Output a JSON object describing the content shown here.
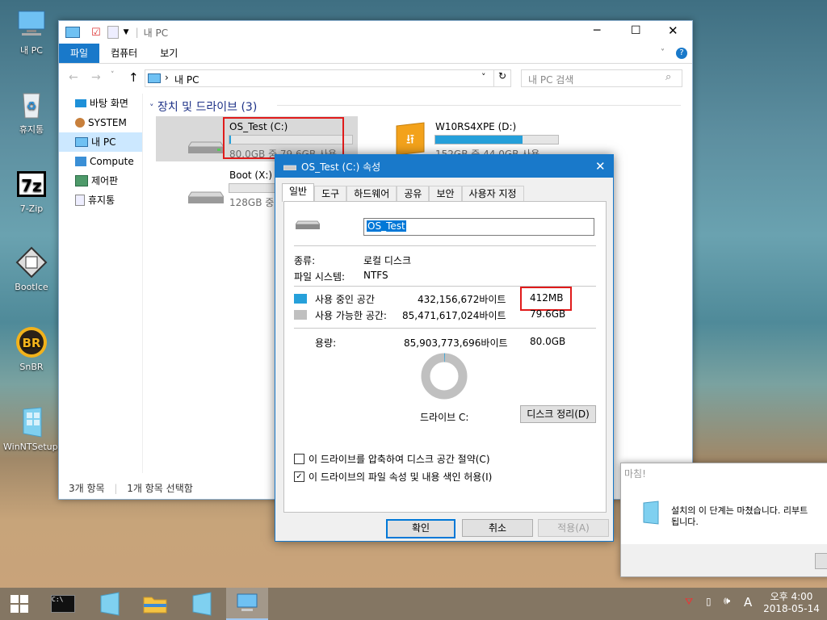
{
  "desktop_icons": [
    {
      "label": "내 PC",
      "icon": "this-pc-icon"
    },
    {
      "label": "휴지통",
      "icon": "recycle-bin-icon"
    },
    {
      "label": "7-Zip",
      "icon": "7zip-icon"
    },
    {
      "label": "BootIce",
      "icon": "bootice-icon"
    },
    {
      "label": "SnBR",
      "icon": "snbr-icon"
    },
    {
      "label": "WinNTSetup:",
      "icon": "winntsetup-icon"
    }
  ],
  "explorer": {
    "title": "내 PC",
    "ribbon_tabs": [
      "파일",
      "컴퓨터",
      "보기"
    ],
    "address_path": "내 PC",
    "search_placeholder": "내 PC 검색",
    "section_header": "장치 및 드라이브 (3)",
    "nav_items": [
      "바탕 화면",
      "SYSTEM",
      "내 PC",
      "Compute",
      "제어판",
      "휴지통"
    ],
    "drives": [
      {
        "name": "OS_Test (C:)",
        "info": "80.0GB 중 79.6GB 사용",
        "fill": 0.01
      },
      {
        "name": "W10RS4XPE (D:)",
        "info": "152GB 중 44.0GB 사용",
        "fill": 0.71
      },
      {
        "name": "Boot (X:)",
        "info": "128GB 중",
        "fill": 0.0
      }
    ],
    "status_items": "3개 항목",
    "status_selected": "1개 항목 선택함"
  },
  "properties": {
    "title": "OS_Test (C:) 속성",
    "tabs": [
      "일반",
      "도구",
      "하드웨어",
      "공유",
      "보안",
      "사용자 지정"
    ],
    "name_value": "OS_Test",
    "type_label": "종류:",
    "type_value": "로컬 디스크",
    "fs_label": "파일 시스템:",
    "fs_value": "NTFS",
    "used_label": "사용 중인 공간",
    "used_bytes": "432,156,672바이트",
    "used_size": "412MB",
    "free_label": "사용 가능한 공간:",
    "free_bytes": "85,471,617,024바이트",
    "free_size": "79.6GB",
    "capacity_label": "용량:",
    "capacity_bytes": "85,903,773,696바이트",
    "capacity_size": "80.0GB",
    "drive_label": "드라이브 C:",
    "cleanup_button": "디스크 정리(D)",
    "compress_label": "이 드라이브를 압축하여 디스크 공간 절약(C)",
    "index_label": "이 드라이브의 파일 속성 및 내용 색인 허용(I)",
    "ok_button": "확인",
    "cancel_button": "취소",
    "apply_button": "적용(A)",
    "used_fraction": 0.005,
    "used_color": "#26a0da",
    "free_color": "#c0c0c0"
  },
  "setup_dialog": {
    "title": "마침!",
    "message_line1": "설치의 이 단계는 마쳤습니다. 리부트",
    "message_line2": "됩니다."
  },
  "taskbar": {
    "time_line1": "오후 4:00",
    "time_line2": "2018-05-14",
    "ime": "A"
  }
}
